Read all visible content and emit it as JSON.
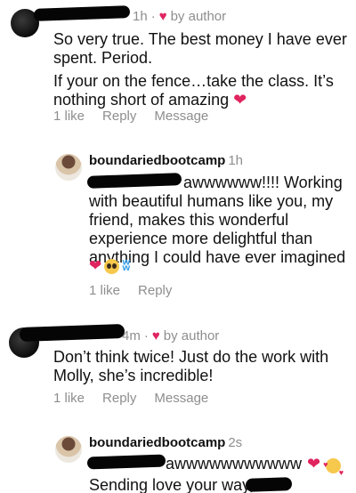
{
  "comments": [
    {
      "time": "1h",
      "liked_by": "by author",
      "paragraphs": [
        "So very true. The best money I have ever spent. Period.",
        "If your on the fence…take the class. It’s nothing short of amazing"
      ],
      "actions": {
        "like": "1 like",
        "reply": "Reply",
        "message": "Message"
      },
      "reply": {
        "username": "boundariedbootcamp",
        "time": "1h",
        "text": "awwwwww!!!! Working with beautiful humans like you, my friend, makes this wonderful experience more delightful than anything I could have ever imagined",
        "emojis": [
          "red-heart",
          "pleading-face",
          "butterfly"
        ],
        "actions": {
          "like": "1 like",
          "reply": "Reply"
        }
      }
    },
    {
      "time": "4m",
      "liked_by": "by author",
      "paragraphs": [
        "Don’t think twice! Just do the work with Molly, she’s incredible!"
      ],
      "actions": {
        "like": "1 like",
        "reply": "Reply",
        "message": "Message"
      },
      "reply": {
        "username": "boundariedbootcamp",
        "time": "2s",
        "text": "awwwwwwwwwww",
        "emojis": [
          "red-heart",
          "smiling-face-with-hearts"
        ],
        "text2": "Sending love your way,"
      }
    }
  ],
  "colors": {
    "heart": "#e0245e",
    "secondary_text": "#8e8e8e"
  }
}
